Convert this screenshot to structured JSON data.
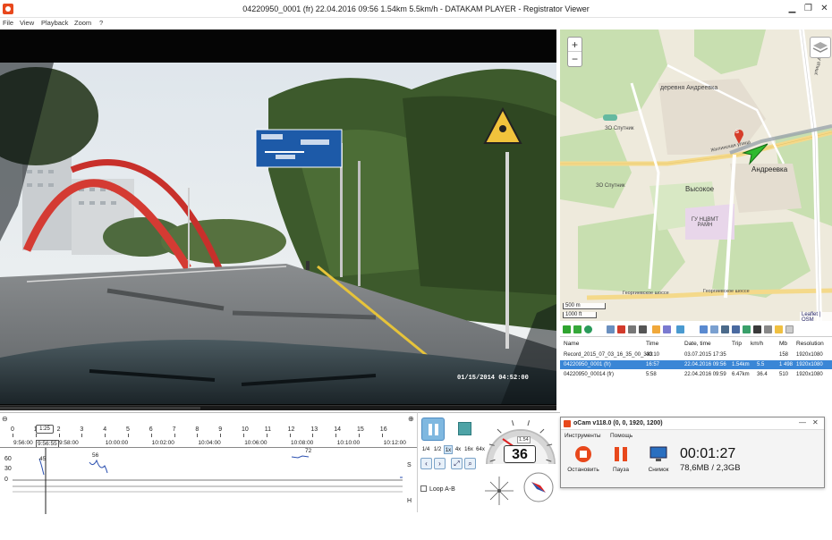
{
  "window": {
    "title": "04220950_0001 (fr)   22.04.2016 09:56   1.54km   5.5km/h   -   DATAKAM PLAYER - Registrator Viewer",
    "minimize": "▁",
    "restore": "❐",
    "close": "✕"
  },
  "menu": [
    "File",
    "View",
    "Playback",
    "Zoom",
    "?"
  ],
  "video": {
    "timestamp": "01/15/2014  04:52:00",
    "progress": 0.36
  },
  "timeline": {
    "numbers": [
      "0",
      "1",
      "2",
      "3",
      "4",
      "5",
      "6",
      "7",
      "8",
      "9",
      "10",
      "11",
      "12",
      "13",
      "14",
      "15",
      "16"
    ],
    "marker_label": "1:25",
    "cursor_time": "9:56:55",
    "start_time": "9:56:00",
    "times": [
      "9:58:00",
      "10:00:00",
      "10:02:00",
      "10:04:00",
      "10:06:00",
      "10:08:00",
      "10:10:00",
      "10:12:00"
    ],
    "y_labels": [
      "60",
      "30",
      "0"
    ],
    "speed_values": [
      "45",
      "56",
      "72"
    ],
    "side_labels": [
      "S",
      "H"
    ]
  },
  "controls": {
    "speeds": [
      "1/4",
      "1/2",
      "1x",
      "4x",
      "16x",
      "64x"
    ],
    "active_speed": "1x",
    "loop_label": "Loop A-B"
  },
  "gauge": {
    "speed": "36",
    "odometer": "1.54",
    "ticks": [
      "0",
      "20",
      "40",
      "60",
      "80",
      "100",
      "120",
      "140"
    ]
  },
  "map": {
    "labels": {
      "village": "деревня Андреевка",
      "district": "Андреевка",
      "vysokoe": "Высокое",
      "sputnik1": "ЗО Спутник",
      "sputnik2": "ЗО Спутник",
      "street": "Жилинская улица",
      "georgievskoe": "Георгиевское шоссе",
      "georgievskoe2": "Георгиевское шоссе",
      "institute": "ГУ НЦВМТ РАМН",
      "andreevka_road": "улица Андреевка"
    },
    "scale_m": "500 m",
    "scale_ft": "1000 ft",
    "attribution": "Leaflet | OSM",
    "zoom_in": "+",
    "zoom_out": "−",
    "marker_label": "S"
  },
  "filelist": {
    "columns": [
      "Name",
      "Time",
      "Date, time",
      "Trip",
      "km/h",
      "Mb",
      "Resolution"
    ],
    "rows": [
      {
        "name": "Record_2015_07_03_16_35_00_333",
        "time": "40:10",
        "date": "03.07.2015 17:35",
        "trip": "",
        "kmh": "",
        "mb": "158",
        "res": "1920x1080",
        "selected": false
      },
      {
        "name": "04220950_0001 (fr)",
        "time": "16:57",
        "date": "22.04.2016 09:56",
        "trip": "1.54km",
        "kmh": "5.5",
        "mb": "1 498",
        "res": "1920x1080",
        "selected": true
      },
      {
        "name": "04220950_00014 (fr)",
        "time": "5:58",
        "date": "22.04.2016 09:59",
        "trip": "6.47km",
        "kmh": "36.4",
        "mb": "510",
        "res": "1920x1080",
        "selected": false
      }
    ]
  },
  "ocam": {
    "title": "oCam v118.0 (0, 0, 1920, 1200)",
    "menu": [
      "Инструменты",
      "Помощь"
    ],
    "buttons": [
      "Остановить",
      "Пауза",
      "Снимок"
    ],
    "elapsed": "00:01:27",
    "size": "78,6MB / 2,3GB",
    "minimize": "—",
    "close": "✕"
  },
  "colors": {
    "accent": "#3a86d6",
    "record_red": "#e8481c",
    "speed_trace": "#2a4fb0",
    "map_green": "#c8dfb0",
    "map_road": "#ffffff",
    "map_yellow_road": "#f4d98a"
  }
}
